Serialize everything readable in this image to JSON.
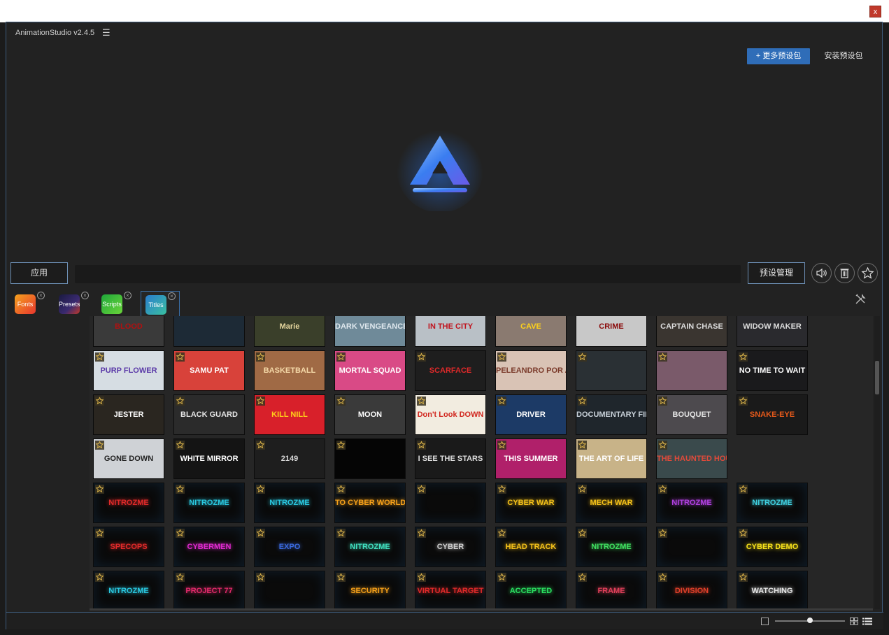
{
  "window": {
    "close_label": "x"
  },
  "app": {
    "title": "AnimationStudio v2.4.5",
    "menu_icon": "hamburger-icon"
  },
  "header": {
    "more_presets_label": "+ 更多预设包",
    "install_presets_label": "安装预设包"
  },
  "toolbar": {
    "apply_label": "应用",
    "search_value": "",
    "manage_label": "预设管理",
    "icons": [
      "speaker-icon",
      "trash-icon",
      "star-icon"
    ]
  },
  "tabs": [
    {
      "label": "Fonts",
      "color": "#f26a2e",
      "active": false
    },
    {
      "label": "Presets",
      "color": "#2c3e7a",
      "active": false
    },
    {
      "label": "Scripts",
      "color": "#2fbf4a",
      "active": false
    },
    {
      "label": "Titles",
      "color": "#2e8fcf",
      "active": true
    }
  ],
  "accent": "#2f6db8",
  "thumbnails": [
    [
      {
        "text": "BLOOD",
        "bg": "#3a3a3a",
        "fg": "#b01010"
      },
      {
        "text": "",
        "bg": "#1d2a36",
        "fg": "#ffffff"
      },
      {
        "text": "Marie",
        "bg": "#3a3f2a",
        "fg": "#e8d8a0"
      },
      {
        "text": "DARK VENGEANCE",
        "bg": "#6f8a99",
        "fg": "#dfe8ee"
      },
      {
        "text": "IN THE CITY",
        "bg": "#b9c0c6",
        "fg": "#c0141e"
      },
      {
        "text": "CAVE",
        "bg": "#8a7a70",
        "fg": "#ffd21a"
      },
      {
        "text": "CRIME",
        "bg": "#c8c8c8",
        "fg": "#8a0a0a"
      },
      {
        "text": "CAPTAIN CHASE",
        "bg": "#3a3530",
        "fg": "#dddddd"
      },
      {
        "text": "WIDOW MAKER",
        "bg": "#2a2a2e",
        "fg": "#dddddd"
      }
    ],
    [
      {
        "text": "PURP FLOWER",
        "bg": "#d6dde3",
        "fg": "#5b3aa8"
      },
      {
        "text": "SAMU PAT",
        "bg": "#d8423a",
        "fg": "#ffffff"
      },
      {
        "text": "BASKETBALL",
        "bg": "#a06a45",
        "fg": "#f5d9a8"
      },
      {
        "text": "MORTAL SQUAD",
        "bg": "#d94a86",
        "fg": "#ffffff"
      },
      {
        "text": "SCARFACE",
        "bg": "#1e1e1e",
        "fg": "#e02a2a"
      },
      {
        "text": "PELEANDRO POR AMOR",
        "bg": "#d9c3b5",
        "fg": "#7a3a2a"
      },
      {
        "text": "",
        "bg": "#2a3034",
        "fg": "#ffffff"
      },
      {
        "text": "",
        "bg": "#7a5a6a",
        "fg": "#ffffff"
      },
      {
        "text": "NO TIME TO WAIT",
        "bg": "#1a1a1c",
        "fg": "#ffffff"
      }
    ],
    [
      {
        "text": "JESTER",
        "bg": "#2a2620",
        "fg": "#ffffff"
      },
      {
        "text": "BLACK GUARD",
        "bg": "#2b2b2b",
        "fg": "#e6e6e6"
      },
      {
        "text": "KILL NILL",
        "bg": "#d8202a",
        "fg": "#ffd21a"
      },
      {
        "text": "MOON",
        "bg": "#3a3a3a",
        "fg": "#ffffff"
      },
      {
        "text": "Don't Look DOWN",
        "bg": "#f2ece0",
        "fg": "#d1261e"
      },
      {
        "text": "DRIVER",
        "bg": "#1c3a66",
        "fg": "#ffffff"
      },
      {
        "text": "DOCUMENTARY FILM",
        "bg": "#1f262c",
        "fg": "#c9d2da"
      },
      {
        "text": "BOUQUET",
        "bg": "#4d4a4e",
        "fg": "#e6e6e6"
      },
      {
        "text": "SNAKE-EYE",
        "bg": "#1a1a1a",
        "fg": "#e85a1a"
      }
    ],
    [
      {
        "text": "GONE DOWN",
        "bg": "#cfd2d6",
        "fg": "#222222"
      },
      {
        "text": "WHITE MIRROR",
        "bg": "#141414",
        "fg": "#ffffff"
      },
      {
        "text": "2149",
        "bg": "#1e1e1e",
        "fg": "#d8d8d8"
      },
      {
        "text": "",
        "bg": "#050505",
        "fg": "#ffffff"
      },
      {
        "text": "I SEE THE STARS",
        "bg": "#1a1a1a",
        "fg": "#dddddd"
      },
      {
        "text": "THIS SUMMER",
        "bg": "#b0206a",
        "fg": "#ffffff"
      },
      {
        "text": "THE ART OF LIFE",
        "bg": "#c8b388",
        "fg": "#ffffff"
      },
      {
        "text": "THE HAUNTED HOUSE",
        "bg": "#3a4a4c",
        "fg": "#e04a3a"
      }
    ],
    [
      {
        "text": "NITROZME",
        "bg": "#0a0a0a",
        "fg": "#e02a2a"
      },
      {
        "text": "NITROZME",
        "bg": "#0a0a0a",
        "fg": "#2ac8e0"
      },
      {
        "text": "NITROZME",
        "bg": "#0a0a0a",
        "fg": "#2ac8e0"
      },
      {
        "text": "TO CYBER WORLD",
        "bg": "#0a0a0a",
        "fg": "#f5a01a"
      },
      {
        "text": "",
        "bg": "#0a0a0a",
        "fg": "#e02a80"
      },
      {
        "text": "CYBER WAR",
        "bg": "#0a0a0a",
        "fg": "#f5c21a"
      },
      {
        "text": "MECH WAR",
        "bg": "#0a0a0a",
        "fg": "#f5c21a"
      },
      {
        "text": "NITROZME",
        "bg": "#0a0a0a",
        "fg": "#b040e0"
      },
      {
        "text": "NITROZME",
        "bg": "#0a0a0a",
        "fg": "#40d0e0"
      }
    ],
    [
      {
        "text": "SPECOPS",
        "bg": "#0a0a0a",
        "fg": "#e02a2a"
      },
      {
        "text": "CYBERMEN",
        "bg": "#0a0a0a",
        "fg": "#e02ad0"
      },
      {
        "text": "EXPO",
        "bg": "#0a0a0a",
        "fg": "#3a6ae0"
      },
      {
        "text": "NITROZME",
        "bg": "#0a0a0a",
        "fg": "#40e0c0"
      },
      {
        "text": "CYBER",
        "bg": "#0a0a0a",
        "fg": "#cfcfcf"
      },
      {
        "text": "HEAD TRACK",
        "bg": "#0a0a0a",
        "fg": "#f5c21a"
      },
      {
        "text": "NITROZME",
        "bg": "#0a0a0a",
        "fg": "#40e060"
      },
      {
        "text": "",
        "bg": "#0a0a0a",
        "fg": "#3a6ae0"
      },
      {
        "text": "CYBER DEMO",
        "bg": "#0a0a0a",
        "fg": "#f5e01a"
      }
    ],
    [
      {
        "text": "NITROZME",
        "bg": "#0a0a0a",
        "fg": "#2ac8e0"
      },
      {
        "text": "PROJECT 77",
        "bg": "#0a0a0a",
        "fg": "#e02a6a"
      },
      {
        "text": "",
        "bg": "#0a0a0a",
        "fg": "#40e060"
      },
      {
        "text": "SECURITY",
        "bg": "#0a0a0a",
        "fg": "#f5a01a"
      },
      {
        "text": "VIRTUAL TARGET",
        "bg": "#0a0a0a",
        "fg": "#e02a2a"
      },
      {
        "text": "ACCEPTED",
        "bg": "#0a0a0a",
        "fg": "#2ae060"
      },
      {
        "text": "FRAME",
        "bg": "#0a0a0a",
        "fg": "#e0405a"
      },
      {
        "text": "DIVISION",
        "bg": "#0a0a0a",
        "fg": "#e0402a"
      },
      {
        "text": "WATCHING",
        "bg": "#0a0a0a",
        "fg": "#e6e6e6"
      }
    ]
  ],
  "status": {
    "icons": [
      "fit-icon",
      "grid-view-icon",
      "list-view-icon"
    ],
    "zoom_fraction": 0.5
  }
}
